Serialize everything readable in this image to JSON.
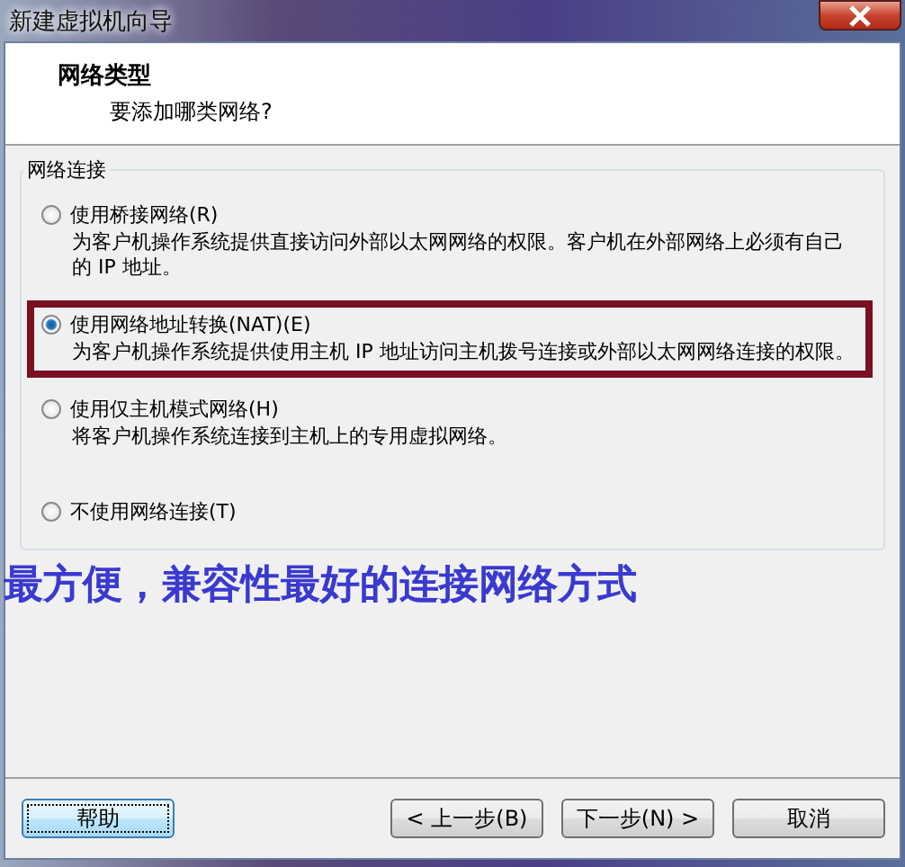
{
  "window": {
    "title": "新建虚拟机向导"
  },
  "header": {
    "title": "网络类型",
    "subtitle": "要添加哪类网络?"
  },
  "group": {
    "legend": "网络连接",
    "options": [
      {
        "label": "使用桥接网络(R)",
        "description": "为客户机操作系统提供直接访问外部以太网网络的权限。客户机在外部网络上必须有自己的 IP 地址。",
        "selected": false,
        "highlighted": false
      },
      {
        "label": "使用网络地址转换(NAT)(E)",
        "description": "为客户机操作系统提供使用主机 IP 地址访问主机拨号连接或外部以太网网络连接的权限。",
        "selected": true,
        "highlighted": true
      },
      {
        "label": "使用仅主机模式网络(H)",
        "description": "将客户机操作系统连接到主机上的专用虚拟网络。",
        "selected": false,
        "highlighted": false
      },
      {
        "label": "不使用网络连接(T)",
        "selected": false,
        "highlighted": false
      }
    ]
  },
  "annotation": {
    "text": "最方便，兼容性最好的连接网络方式"
  },
  "buttons": [
    {
      "label": "帮助",
      "kind": "help"
    },
    {
      "label": "< 上一步(B)",
      "kind": "nav"
    },
    {
      "label": "下一步(N) >",
      "kind": "nav"
    },
    {
      "label": "取消",
      "kind": "nav"
    }
  ]
}
